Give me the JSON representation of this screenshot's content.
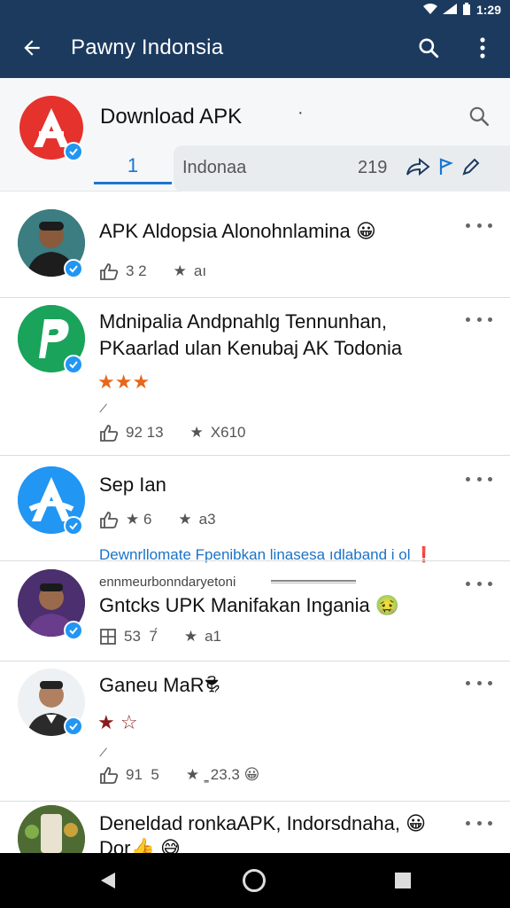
{
  "status_bar": {
    "time": "1:29"
  },
  "app_bar": {
    "title": "Pawny Indonsia"
  },
  "header": {
    "title": "Download APK",
    "dot": "·",
    "tab_label": "1",
    "bar_text": "Indonaa",
    "bar_count": "219"
  },
  "items": [
    {
      "title": "APK Aldopsia Alonohnlamina 😀",
      "likes": "3 2",
      "rating": "aı"
    },
    {
      "title_line1": "Mdnipalia Andpnahlg Tennunhan,",
      "title_line2": "PKaarlad ulan Kenubaj AK Todonia",
      "stars": "★★★",
      "tiny": "⁄",
      "likes": "92 13",
      "rating": "X610"
    },
    {
      "title": "Sep Ian",
      "likes": "★ 6",
      "rating": "a3"
    },
    {
      "title": "Gntcks UPK Manifakan Ingania 🤢",
      "likes": "53  7́",
      "rating": "a1"
    },
    {
      "title": "Ganeu MaR🕏",
      "stars": "★ ☆",
      "tiny": "⁄",
      "likes": "91  5",
      "rating": "̳ 23.3 😀"
    },
    {
      "title": "Deneldad ronkaAPK, Indorsdnaha, 😀",
      "subtitle": "Dor👍 😅"
    }
  ],
  "banner": {
    "text": "Dewnrllomate Fpenibkan linasesa ıdlaband i ol",
    "sub": "ennmeurbonndaryetoni"
  },
  "colors": {
    "app_bar": "#1c3a5e",
    "accent": "#1976d2",
    "verified_badge": "#2196f3",
    "logo_red": "#e5322d",
    "logo_green": "#1aa35a",
    "logo_blue": "#2196f3"
  },
  "icons": {
    "back": "arrow-left-icon",
    "search": "search-icon",
    "more": "more-vertical-icon",
    "share": "share-icon",
    "edit": "pencil-icon",
    "like": "thumbs-up-icon",
    "star": "star-icon",
    "verified": "verified-check-icon"
  }
}
